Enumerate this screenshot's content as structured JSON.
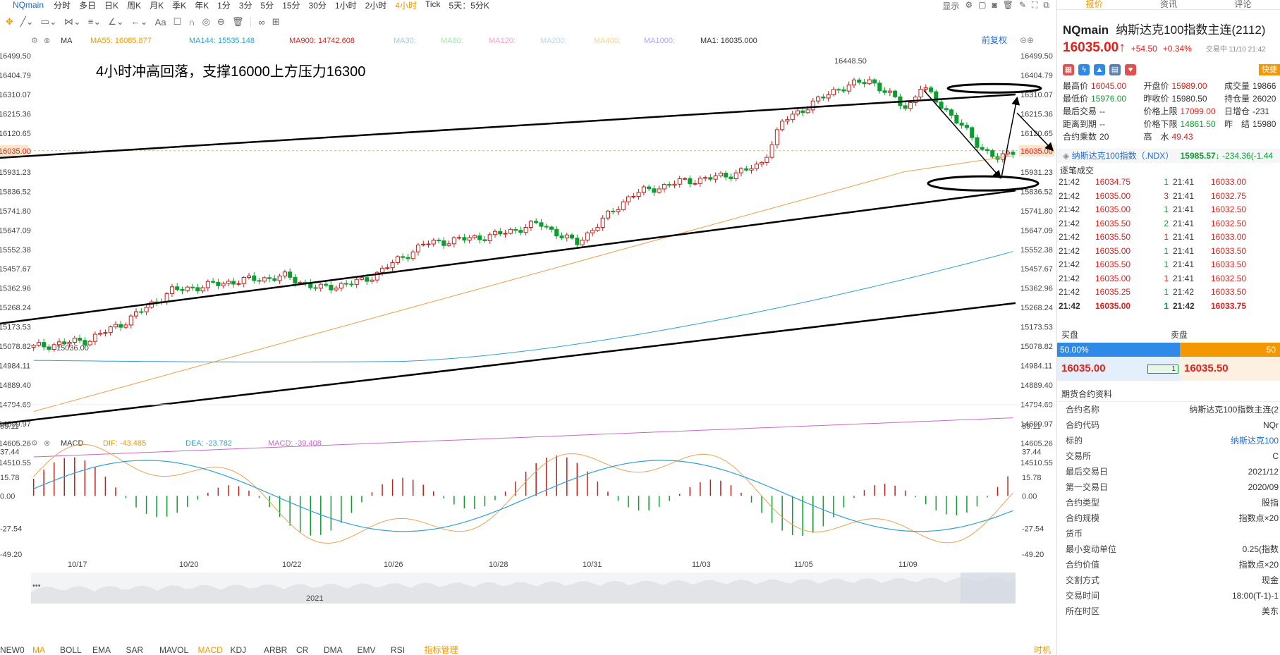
{
  "topbar": {
    "symbol": "NQmain",
    "periods": [
      {
        "label": "分时",
        "active": false
      },
      {
        "label": "多日",
        "active": false
      },
      {
        "label": "日K",
        "active": false
      },
      {
        "label": "周K",
        "active": false
      },
      {
        "label": "月K",
        "active": false
      },
      {
        "label": "季K",
        "active": false
      },
      {
        "label": "年K",
        "active": false
      },
      {
        "label": "1分",
        "active": false
      },
      {
        "label": "3分",
        "active": false
      },
      {
        "label": "5分",
        "active": false
      },
      {
        "label": "15分",
        "active": false
      },
      {
        "label": "30分",
        "active": false
      },
      {
        "label": "1小时",
        "active": false
      },
      {
        "label": "2小时",
        "active": false
      },
      {
        "label": "4小时",
        "active": true
      },
      {
        "label": "Tick",
        "active": false
      },
      {
        "label": "5天：5分K",
        "active": false
      }
    ],
    "display_label": "显示"
  },
  "chart": {
    "ma_label": "MA",
    "ma_items": [
      {
        "text": "MA55: 16085.877",
        "color": "#f39800"
      },
      {
        "text": "MA144: 15535.148",
        "color": "#2ea2d4"
      },
      {
        "text": "MA900: 14742.608",
        "color": "#e0201a"
      },
      {
        "text": "MA30:",
        "color": "#9ccbf0"
      },
      {
        "text": "MA60:",
        "color": "#a6e0b4"
      },
      {
        "text": "MA120:",
        "color": "#f4a6c6"
      },
      {
        "text": "MA200:",
        "color": "#b8d8f5"
      },
      {
        "text": "MA400:",
        "color": "#f8d48a"
      },
      {
        "text": "MA1000:",
        "color": "#b3a6f0"
      },
      {
        "text": "MA1: 16035.000",
        "color": "#333333"
      }
    ],
    "fq_label": "前复权",
    "annotation": "4小时冲高回落，支撑16000上方压力16300",
    "high_label": "16448.50",
    "low_label": "15036.00",
    "current_price_tag": "16035.00",
    "y_ticks": [
      "16499.50",
      "16404.79",
      "16310.07",
      "16215.36",
      "16120.65",
      "16035.00",
      "15931.23",
      "15836.52",
      "15741.80",
      "15647.09",
      "15552.38",
      "15457.67",
      "15362.96",
      "15268.24",
      "15173.53",
      "15078.82",
      "14984.11",
      "14889.40",
      "14794.69",
      "14699.97",
      "14605.26",
      "14510.55"
    ],
    "x_ticks": [
      "10/17",
      "10/20",
      "10/22",
      "10/26",
      "10/28",
      "10/31",
      "11/03",
      "11/05",
      "11/09"
    ],
    "year_label": "2021",
    "macd": {
      "label": "MACD",
      "dif": "DIF: -43.485",
      "dea": "DEA: -23.782",
      "macd": "MACD: -39.408",
      "y_ticks": [
        "59.11",
        "37.44",
        "15.78",
        "0.00",
        "-27.54",
        "-49.20"
      ]
    },
    "bottom_tabs": [
      "NEW0",
      "MA",
      "BOLL",
      "EMA",
      "SAR",
      "MAVOL",
      "MACD",
      "KDJ",
      "ARBR",
      "CR",
      "DMA",
      "EMV",
      "RSI",
      "指标管理"
    ],
    "bottom_active": "MACD",
    "bottom_right": "时机"
  },
  "chart_data": {
    "type": "candlestick",
    "series": [
      {
        "name": "MA55",
        "color": "#f39800"
      },
      {
        "name": "MA144",
        "color": "#2ea2d4"
      },
      {
        "name": "MA900",
        "color": "#cc66cc"
      }
    ],
    "ylim": [
      14510.55,
      16499.5
    ],
    "macd_ylim": [
      -49.2,
      59.11
    ]
  },
  "panel": {
    "tabs": [
      "报价",
      "资讯",
      "评论"
    ],
    "code": "NQmain",
    "name": "纳斯达克100指数主连(2112)",
    "price": "16035.00",
    "change": "+54.50",
    "change_pct": "+0.34%",
    "status": "交易中 11/10 21:42",
    "fast_label": "快捷",
    "stats": [
      [
        {
          "k": "最高价",
          "v": "16045.00",
          "c": "red"
        },
        {
          "k": "开盘价",
          "v": "15989.00",
          "c": "red"
        },
        {
          "k": "成交量",
          "v": "19866",
          "c": ""
        }
      ],
      [
        {
          "k": "最低价",
          "v": "15976.00",
          "c": "green"
        },
        {
          "k": "昨收价",
          "v": "15980.50",
          "c": ""
        },
        {
          "k": "持仓量",
          "v": "26020",
          "c": ""
        }
      ],
      [
        {
          "k": "最后交易",
          "v": "--",
          "c": ""
        },
        {
          "k": "价格上限",
          "v": "17099.00",
          "c": "red"
        },
        {
          "k": "日增仓",
          "v": "-231",
          "c": ""
        }
      ],
      [
        {
          "k": "距离到期",
          "v": "--",
          "c": ""
        },
        {
          "k": "价格下限",
          "v": "14861.50",
          "c": "green"
        },
        {
          "k": "昨　结",
          "v": "15980",
          "c": ""
        }
      ],
      [
        {
          "k": "合约乘数",
          "v": "20",
          "c": ""
        },
        {
          "k": "高　水",
          "v": "49.43",
          "c": "red"
        },
        {
          "k": "",
          "v": "",
          "c": ""
        }
      ]
    ],
    "index_name": "纳斯达克100指数（.NDX）",
    "index_price": "15985.57↓",
    "index_change": "-234.36(-1.44",
    "deals_title": "逐笔成交",
    "deals": [
      [
        "21:42",
        "16034.75",
        "1",
        "21:41",
        "16033.00"
      ],
      [
        "21:42",
        "16035.00",
        "3",
        "21:41",
        "16032.75"
      ],
      [
        "21:42",
        "16035.00",
        "1",
        "21:41",
        "16032.50"
      ],
      [
        "21:42",
        "16035.50",
        "2",
        "21:41",
        "16032.50"
      ],
      [
        "21:42",
        "16035.50",
        "1",
        "21:41",
        "16033.00"
      ],
      [
        "21:42",
        "16035.00",
        "1",
        "21:41",
        "16033.50"
      ],
      [
        "21:42",
        "16035.50",
        "1",
        "21:41",
        "16033.50"
      ],
      [
        "21:42",
        "16035.00",
        "1",
        "21:41",
        "16032.50"
      ],
      [
        "21:42",
        "16035.25",
        "1",
        "21:42",
        "16033.50"
      ],
      [
        "21:42",
        "16035.00",
        "1",
        "21:42",
        "16033.75"
      ]
    ],
    "buy_label": "买盘",
    "sell_label": "卖盘",
    "buy_pct": "50.00%",
    "sell_pct": "50",
    "buy_price": "16035.00",
    "buy_qty": "1",
    "sell_price": "16035.50",
    "info_title": "期货合约资料",
    "info": [
      {
        "k": "合约名称",
        "v": "纳斯达克100指数主连(2",
        "link": false
      },
      {
        "k": "合约代码",
        "v": "NQr",
        "link": false
      },
      {
        "k": "标的",
        "v": "纳斯达克100",
        "link": true
      },
      {
        "k": "交易所",
        "v": "C",
        "link": false
      },
      {
        "k": "最后交易日",
        "v": "2021/12",
        "link": false
      },
      {
        "k": "第一交易日",
        "v": "2020/09",
        "link": false
      },
      {
        "k": "合约类型",
        "v": "股指",
        "link": false
      },
      {
        "k": "合约规模",
        "v": "指数点×20",
        "link": false
      },
      {
        "k": "货币",
        "v": "",
        "link": false
      },
      {
        "k": "最小变动单位",
        "v": "0.25(指数",
        "link": false
      },
      {
        "k": "合约价值",
        "v": "指数点×20",
        "link": false
      },
      {
        "k": "交割方式",
        "v": "现金",
        "link": false
      },
      {
        "k": "交易时间",
        "v": "18:00(T-1)-1",
        "link": false
      },
      {
        "k": "所在时区",
        "v": "美东",
        "link": false
      }
    ]
  }
}
